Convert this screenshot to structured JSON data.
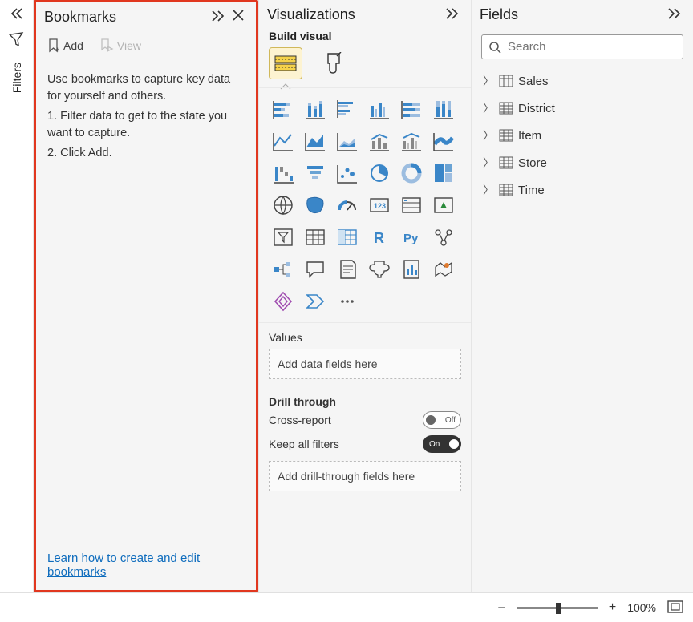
{
  "filters_rail": {
    "label": "Filters"
  },
  "bookmarks": {
    "title": "Bookmarks",
    "add_label": "Add",
    "view_label": "View",
    "intro": "Use bookmarks to capture key data for yourself and others.",
    "step1": "1. Filter data to get to the state you want to capture.",
    "step2": "2. Click Add.",
    "link_text": "Learn how to create and edit bookmarks"
  },
  "viz": {
    "title": "Visualizations",
    "subtitle": "Build visual",
    "values_label": "Values",
    "values_placeholder": "Add data fields here",
    "drill_label": "Drill through",
    "cross_report_label": "Cross-report",
    "cross_report_state": "Off",
    "keep_filters_label": "Keep all filters",
    "keep_filters_state": "On",
    "drill_placeholder": "Add drill-through fields here",
    "r_label": "R",
    "py_label": "Py"
  },
  "fields": {
    "title": "Fields",
    "search_placeholder": "Search",
    "items": [
      {
        "name": "Sales",
        "icon": "calc"
      },
      {
        "name": "District",
        "icon": "table"
      },
      {
        "name": "Item",
        "icon": "table"
      },
      {
        "name": "Store",
        "icon": "table"
      },
      {
        "name": "Time",
        "icon": "table"
      }
    ]
  },
  "footer": {
    "minus": "−",
    "plus": "+",
    "zoom": "100%"
  }
}
